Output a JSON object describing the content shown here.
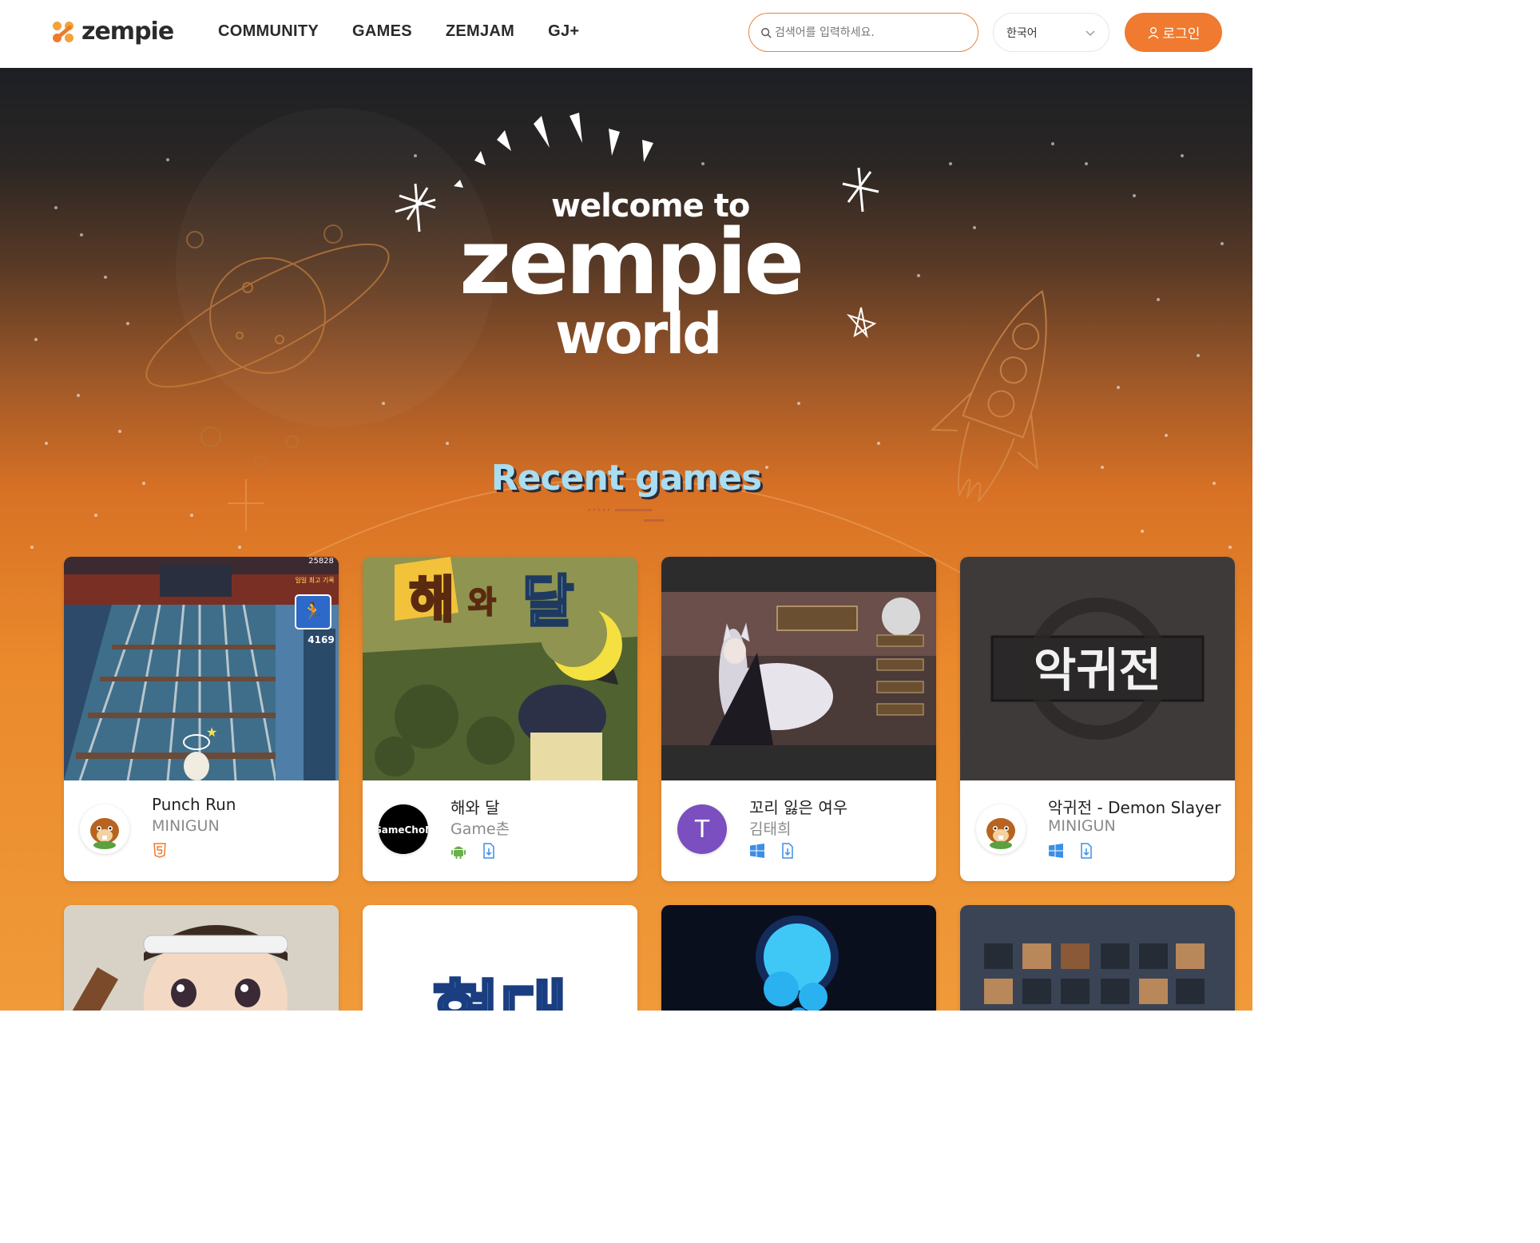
{
  "header": {
    "logo_text": "zempie",
    "nav": [
      "COMMUNITY",
      "GAMES",
      "ZEMJAM",
      "GJ+"
    ],
    "search_placeholder": "검색어를 입력하세요.",
    "language": "한국어",
    "login_label": "로그인"
  },
  "hero": {
    "welcome": "welcome to",
    "zempie": "zempie",
    "world": "world",
    "section_title": "Recent games"
  },
  "games": [
    {
      "title": "Punch Run",
      "author": "MINIGUN",
      "platforms": [
        "html5-icon"
      ],
      "thumb_score": "25828",
      "thumb_best_label": "일일 최고 기록",
      "thumb_distance": "4169"
    },
    {
      "title": "해와 달",
      "author": "Game촌",
      "platforms": [
        "android-icon",
        "download-icon"
      ],
      "thumb_text_1": "해",
      "thumb_text_2": "와",
      "thumb_text_3": "달",
      "avatar_text": "GameChoN"
    },
    {
      "title": "꼬리 잃은 여우",
      "author": "김태희",
      "platforms": [
        "windows-icon",
        "download-icon"
      ],
      "avatar_letter": "T"
    },
    {
      "title": "악귀전 - Demon Slayer",
      "author": "MINIGUN",
      "platforms": [
        "windows-icon",
        "download-icon"
      ],
      "thumb_text": "악귀전"
    },
    {
      "title": "",
      "author": "",
      "platforms": []
    },
    {
      "title": "",
      "author": "",
      "platforms": [],
      "thumb_text": "혈대"
    },
    {
      "title": "",
      "author": "",
      "platforms": []
    },
    {
      "title": "",
      "author": "",
      "platforms": []
    }
  ],
  "colors": {
    "accent": "#ef7a30",
    "title_blue": "#a9ddf2",
    "android": "#6ab04c",
    "windows": "#3b8fe6",
    "download": "#3b8fe6",
    "html5": "#ef7a30",
    "avatar_purple": "#7b4fbf"
  }
}
